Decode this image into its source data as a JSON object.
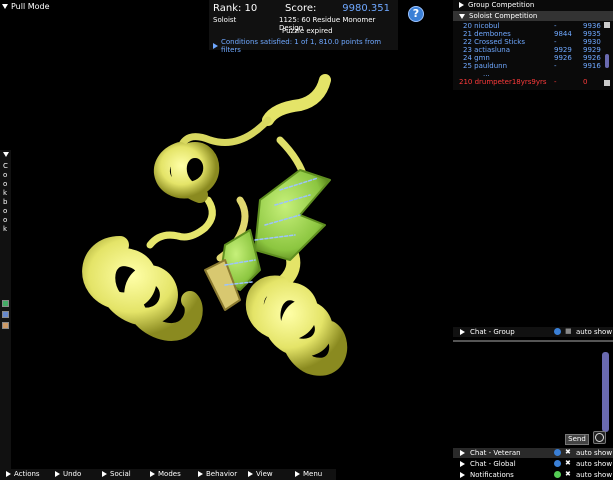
{
  "pull_mode": "Pull Mode",
  "score_panel": {
    "rank": "Rank: 10",
    "score_label": "Score:",
    "score_value": "9980.351",
    "mode": "Soloist",
    "puzzle": "1125: 60 Residue Monomer Design",
    "status": "Puzzle expired",
    "conditions": "Conditions satisfied: 1 of 1, 810.0 points from filters"
  },
  "help_label": "?",
  "cookbook": {
    "letters": [
      "C",
      "o",
      "o",
      "k",
      "b",
      "o",
      "o",
      "k"
    ]
  },
  "right_panel": {
    "group_competition": "Group Competition",
    "soloist_competition": "Soloist Competition",
    "rows": [
      {
        "name": "20 nicobul",
        "s1": "-",
        "s2": "9936"
      },
      {
        "name": "21 dembones",
        "s1": "9844",
        "s2": "9935"
      },
      {
        "name": "22 Crossed Sticks",
        "s1": "-",
        "s2": "9930"
      },
      {
        "name": "23 actiasluna",
        "s1": "9929",
        "s2": "9929"
      },
      {
        "name": "24 gmn",
        "s1": "9926",
        "s2": "9926"
      },
      {
        "name": "25 pauldunn",
        "s1": "-",
        "s2": "9916"
      },
      {
        "name": "...",
        "s1": "",
        "s2": ""
      },
      {
        "name": "210 drumpeter18yrs9yrs",
        "s1": "-",
        "s2": "0"
      }
    ]
  },
  "chat": {
    "group": "Chat - Group",
    "veteran": "Chat - Veteran",
    "global": "Chat - Global",
    "notifications": "Notifications",
    "auto_show": "auto show",
    "send": "Send"
  },
  "bottom_bar": [
    "Actions",
    "Undo",
    "Social",
    "Modes",
    "Behavior",
    "View",
    "Menu"
  ],
  "colors": {
    "accent": "#6fa8ff",
    "me": "#ff3b3b",
    "helix": "#e8e870",
    "sheet": "#8fcc40"
  }
}
